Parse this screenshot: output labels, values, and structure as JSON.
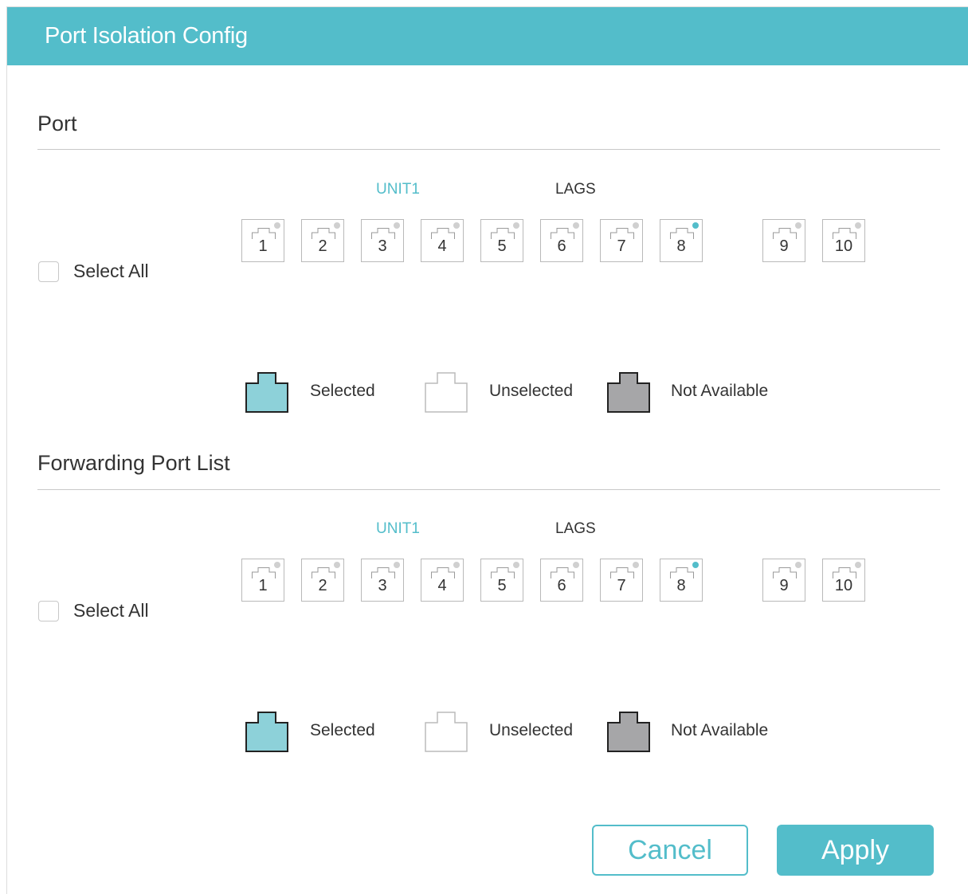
{
  "header": {
    "title": "Port Isolation Config"
  },
  "port_section": {
    "title": "Port",
    "tab_unit": "UNIT1",
    "tab_lags": "LAGS",
    "select_all_label": "Select All",
    "ports": [
      {
        "label": "1",
        "link": false
      },
      {
        "label": "2",
        "link": false
      },
      {
        "label": "3",
        "link": false
      },
      {
        "label": "4",
        "link": false
      },
      {
        "label": "5",
        "link": false
      },
      {
        "label": "6",
        "link": false
      },
      {
        "label": "7",
        "link": false
      },
      {
        "label": "8",
        "link": true
      },
      {
        "label": "9",
        "link": false
      },
      {
        "label": "10",
        "link": false
      }
    ],
    "legend": {
      "selected": "Selected",
      "unselected": "Unselected",
      "not_available": "Not Available"
    }
  },
  "forwarding_section": {
    "title": "Forwarding Port List",
    "tab_unit": "UNIT1",
    "tab_lags": "LAGS",
    "select_all_label": "Select All",
    "ports": [
      {
        "label": "1",
        "link": false
      },
      {
        "label": "2",
        "link": false
      },
      {
        "label": "3",
        "link": false
      },
      {
        "label": "4",
        "link": false
      },
      {
        "label": "5",
        "link": false
      },
      {
        "label": "6",
        "link": false
      },
      {
        "label": "7",
        "link": false
      },
      {
        "label": "8",
        "link": true
      },
      {
        "label": "9",
        "link": false
      },
      {
        "label": "10",
        "link": false
      }
    ],
    "legend": {
      "selected": "Selected",
      "unselected": "Unselected",
      "not_available": "Not Available"
    }
  },
  "buttons": {
    "cancel": "Cancel",
    "apply": "Apply"
  },
  "colors": {
    "accent": "#53bdca",
    "selected_fill": "#8dd1d9",
    "not_available_fill": "#a6a6a8",
    "led_inactive": "#d0d0d0"
  }
}
